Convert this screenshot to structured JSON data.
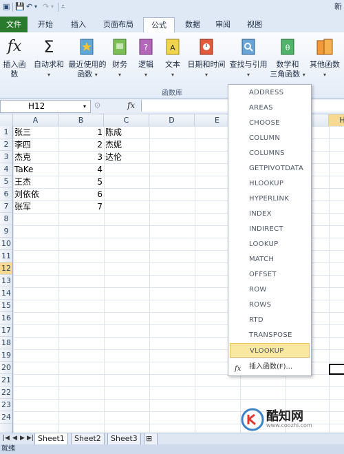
{
  "ribbon_tabs": [
    "文件",
    "开始",
    "插入",
    "页面布局",
    "公式",
    "数据",
    "审阅",
    "视图"
  ],
  "active_tab": "公式",
  "ribbon_buttons": [
    {
      "label": "插入函数"
    },
    {
      "label": "自动求和",
      "caret": true
    },
    {
      "label": "最近使用的",
      "label2": "函数",
      "caret": true
    },
    {
      "label": "财务",
      "caret": true
    },
    {
      "label": "逻辑",
      "caret": true
    },
    {
      "label": "文本",
      "caret": true
    },
    {
      "label": "日期和时间",
      "caret": true
    },
    {
      "label": "查找与引用",
      "caret": true
    },
    {
      "label": "数学和",
      "label2": "三角函数",
      "caret": true
    },
    {
      "label": "其他函数",
      "caret": true
    }
  ],
  "group_label": "函数库",
  "name_box": "H12",
  "fx_label": "fx",
  "corner_right": "新",
  "columns": [
    "A",
    "B",
    "C",
    "D",
    "E",
    "F",
    "G",
    "H"
  ],
  "selected_column": "H",
  "rows": [
    "1",
    "2",
    "3",
    "4",
    "5",
    "6",
    "7",
    "8",
    "9",
    "10",
    "11",
    "12",
    "13",
    "14",
    "15",
    "16",
    "17",
    "18",
    "19",
    "20",
    "21",
    "22",
    "23",
    "24"
  ],
  "selected_row": "12",
  "data": {
    "col_a": [
      "张三",
      "李四",
      "杰克",
      "TaKe",
      "王杰",
      "刘依依",
      "张军"
    ],
    "col_b": [
      "1",
      "2",
      "3",
      "4",
      "5",
      "6",
      "7"
    ],
    "col_c": [
      "陈成",
      "杰妮",
      "达伦"
    ]
  },
  "dropdown": {
    "items": [
      "ADDRESS",
      "AREAS",
      "CHOOSE",
      "COLUMN",
      "COLUMNS",
      "GETPIVOTDATA",
      "HLOOKUP",
      "HYPERLINK",
      "INDEX",
      "INDIRECT",
      "LOOKUP",
      "MATCH",
      "OFFSET",
      "ROW",
      "ROWS",
      "RTD",
      "TRANSPOSE",
      "VLOOKUP"
    ],
    "highlighted": "VLOOKUP",
    "footer": "插入函数(F)..."
  },
  "sheets": [
    "Sheet1",
    "Sheet2",
    "Sheet3"
  ],
  "status_text": "就绪",
  "watermark": {
    "main": "酷知网",
    "sub": "www.coozhi.com"
  }
}
